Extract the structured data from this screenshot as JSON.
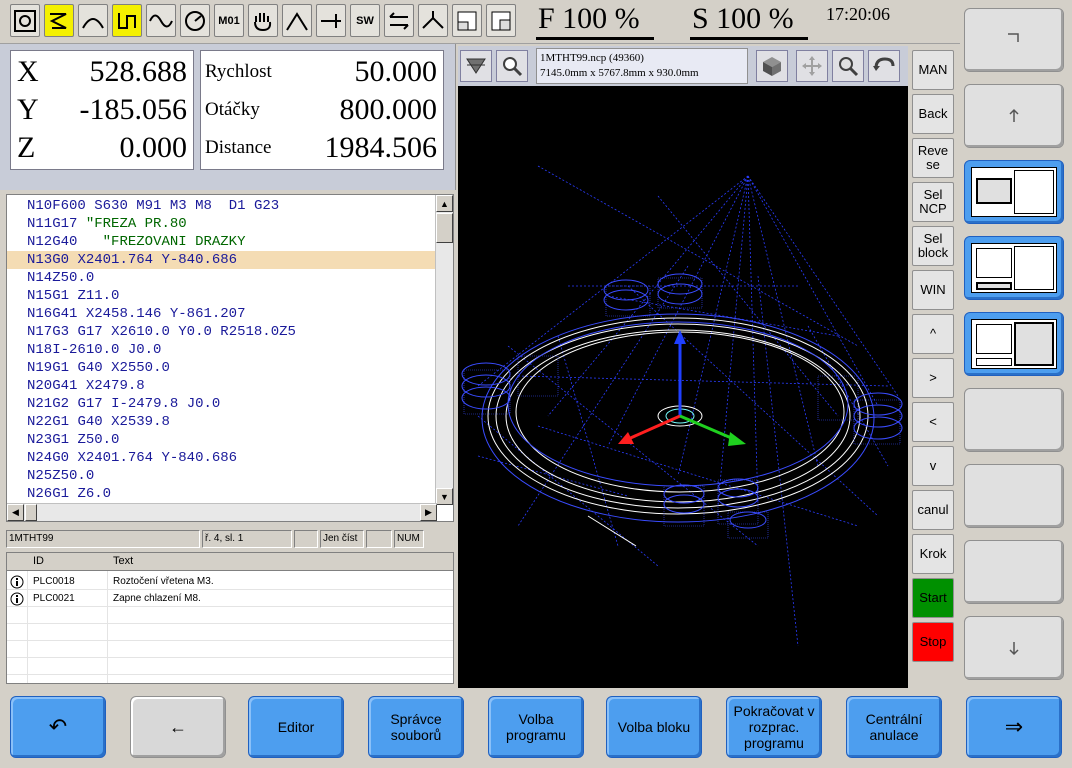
{
  "toolbar": {
    "icons": [
      "machine-icon",
      "program-step-icon",
      "arc-move-icon",
      "toolpath-icon",
      "sine-wave-icon",
      "dial-icon",
      "m01-icon",
      "hand-icon",
      "curve-icon",
      "tool-length-icon",
      "sw-icon",
      "swap-icon",
      "radius-icon",
      "window-small-icon",
      "window-large-icon"
    ],
    "m01_label": "M01",
    "sw_label": "SW",
    "feed_label": "F 100 %",
    "spindle_label": "S 100 %",
    "clock": "17:20:06"
  },
  "position": {
    "x_label": "X",
    "x_value": "528.688",
    "y_label": "Y",
    "y_value": "-185.056",
    "z_label": "Z",
    "z_value": "0.000",
    "speed_label": "Rychlost",
    "speed_value": "50.000",
    "rpm_label": "Otáčky",
    "rpm_value": "800.000",
    "dist_label": "Distance",
    "dist_value": "1984.506"
  },
  "listing": {
    "lines": [
      "N10F600 S630 M91 M3 M8  D1 G23",
      "N11G17 \"FREZA PR.80",
      "N12G40   \"FREZOVANI DRAZKY",
      "N13G0 X2401.764 Y-840.686",
      "N14Z50.0",
      "N15G1 Z11.0",
      "N16G41 X2458.146 Y-861.207",
      "N17G3 G17 X2610.0 Y0.0 R2518.0Z5",
      "N18I-2610.0 J0.0",
      "N19G1 G40 X2550.0",
      "N20G41 X2479.8",
      "N21G2 G17 I-2479.8 J0.0",
      "N22G1 G40 X2539.8",
      "N23G1 Z50.0",
      "N24G0 X2401.764 Y-840.686",
      "N25Z50.0",
      "N26G1 Z6.0"
    ],
    "current_index": 3
  },
  "status": {
    "program": "1MTHT99",
    "position": "ř. 4, sl. 1",
    "mode": "Jen číst",
    "num": "NUM"
  },
  "messages": {
    "col_id": "ID",
    "col_text": "Text",
    "rows": [
      {
        "id": "PLC0018",
        "text": "Roztočení vřetena M3."
      },
      {
        "id": "PLC0021",
        "text": "Zapne chlazení M8."
      }
    ]
  },
  "graphics": {
    "file_name": "1MTHT99.ncp (49360)",
    "file_dims": "7145.0mm x 5767.8mm x 930.0mm"
  },
  "right_column": {
    "man": "MAN",
    "back": "Back",
    "reverse": "Reve se",
    "sel_ncp": "Sel NCP",
    "sel_block": "Sel block",
    "win": "WIN",
    "up": "^",
    "right": ">",
    "left": "<",
    "down": "v",
    "canul": "canul",
    "krok": "Krok",
    "start": "Start",
    "stop": "Stop"
  },
  "softkeys": {
    "undo": "↶",
    "back": "←",
    "editor": "Editor",
    "file_manager": "Správce souborů",
    "select_program": "Volba programu",
    "select_block": "Volba bloku",
    "continue": "Pokračovat v rozprac. programu",
    "central_cancel": "Centrální anulace",
    "next": "⇒"
  },
  "colors": {
    "accent_blue": "#4d9eef",
    "highlight_yellow": "#f4f000",
    "current_line": "#f4dcb4",
    "start_green": "#009000",
    "stop_red": "#ff0000"
  }
}
